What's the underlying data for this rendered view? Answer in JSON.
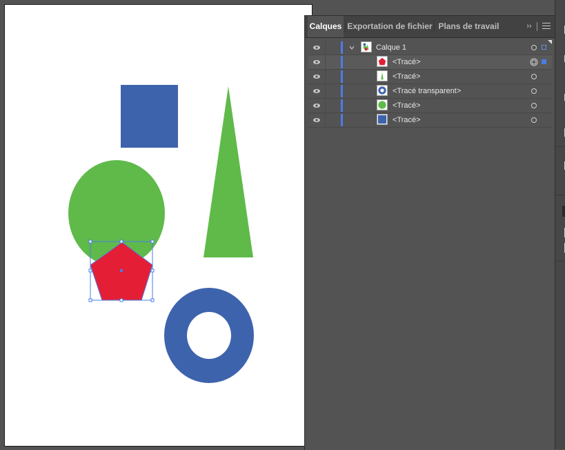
{
  "panel": {
    "tabs": [
      {
        "label": "Calques",
        "active": true
      },
      {
        "label": "Exportation de fichier",
        "active": false
      },
      {
        "label": "Plans de travail",
        "active": false
      }
    ],
    "collapse_icon": "double-chevron-right-icon",
    "menu_icon": "hamburger-menu-icon"
  },
  "layers": {
    "parent": {
      "label": "Calque 1",
      "expanded": true,
      "color": "#4b7ce6"
    },
    "items": [
      {
        "label": "<Tracé>",
        "thumb": "pentagon",
        "targeted": true,
        "selected": true
      },
      {
        "label": "<Tracé>",
        "thumb": "triangle",
        "targeted": false,
        "selected": false
      },
      {
        "label": "<Tracé transparent>",
        "thumb": "ring",
        "targeted": false,
        "selected": false
      },
      {
        "label": "<Tracé>",
        "thumb": "circle",
        "targeted": false,
        "selected": false
      },
      {
        "label": "<Tracé>",
        "thumb": "square",
        "targeted": false,
        "selected": false
      }
    ]
  },
  "artboard": {
    "shapes": [
      "blue-square",
      "green-triangle",
      "green-circle",
      "red-pentagon",
      "blue-ring"
    ],
    "colors": {
      "blue": "#3e63ad",
      "green": "#5fba4a",
      "red": "#e41f35",
      "selection": "#4b7ce6"
    }
  }
}
